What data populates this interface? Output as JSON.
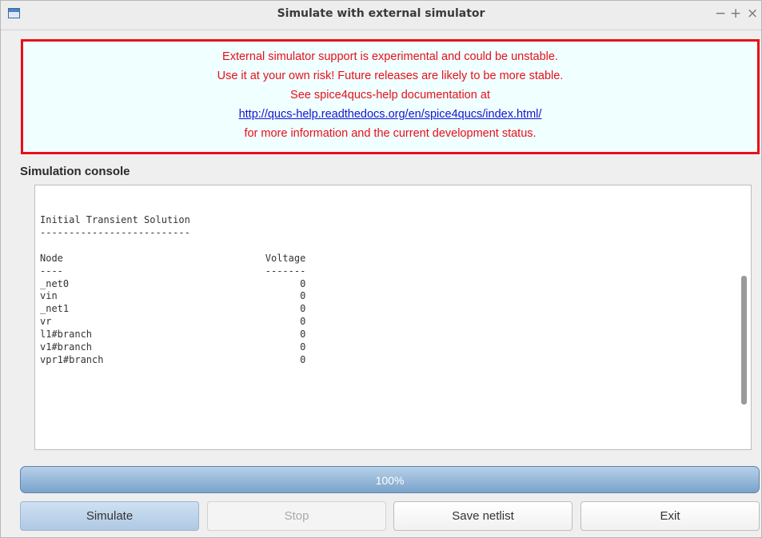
{
  "window": {
    "title": "Simulate with external simulator",
    "minimize_glyph": "−",
    "maximize_glyph": "+",
    "close_glyph": "×"
  },
  "warning": {
    "line1": "External simulator support is experimental and could be unstable.",
    "line2": "Use it at your own risk! Future releases are likely to be more stable.",
    "line3": "See spice4qucs-help documentation at",
    "link": "http://qucs-help.readthedocs.org/en/spice4qucs/index.html/",
    "line5": "for more information and the current development status.",
    "text_color": "#e8101a",
    "border_color": "#e8101a",
    "link_color": "#1414d0"
  },
  "console": {
    "label": "Simulation console",
    "text": "Initial Transient Solution\n--------------------------\n\nNode                                   Voltage\n----                                   -------\n_net0                                        0\nvin                                          0\n_net1                                        0\nvr                                           0\nl1#branch                                    0\nv1#branch                                    0\nvpr1#branch                                  0"
  },
  "progress": {
    "label": "100%",
    "value": 1.0
  },
  "buttons": {
    "simulate": "Simulate",
    "stop": "Stop",
    "save_netlist": "Save netlist",
    "exit": "Exit"
  }
}
